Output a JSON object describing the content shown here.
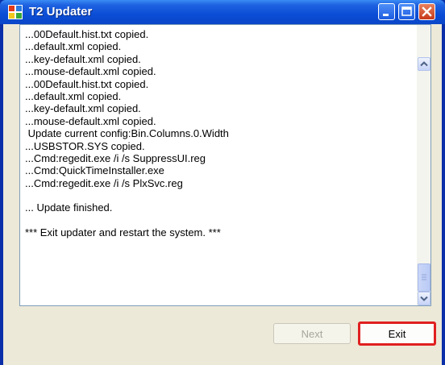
{
  "window": {
    "title": "T2 Updater"
  },
  "log": {
    "lines": [
      "...00Default.hist.txt copied.",
      "...default.xml copied.",
      "...key-default.xml copied.",
      "...mouse-default.xml copied.",
      "...00Default.hist.txt copied.",
      "...default.xml copied.",
      "...key-default.xml copied.",
      "...mouse-default.xml copied.",
      " Update current config:Bin.Columns.0.Width",
      "...USBSTOR.SYS copied.",
      "...Cmd:regedit.exe /i /s SuppressUI.reg",
      "...Cmd:QuickTimeInstaller.exe",
      "...Cmd:regedit.exe /i /s PlxSvc.reg",
      "",
      "... Update finished.",
      "",
      "*** Exit updater and restart the system. ***"
    ]
  },
  "buttons": {
    "next": "Next",
    "exit": "Exit"
  },
  "icons": {
    "app": "app-icon",
    "minimize": "minimize-icon",
    "maximize": "maximize-icon",
    "close": "close-icon",
    "scroll_up": "chevron-up-icon",
    "scroll_down": "chevron-down-icon"
  },
  "colors": {
    "titlebar": "#0b4dd6",
    "close_button": "#c7391a",
    "highlight": "#e02020"
  }
}
